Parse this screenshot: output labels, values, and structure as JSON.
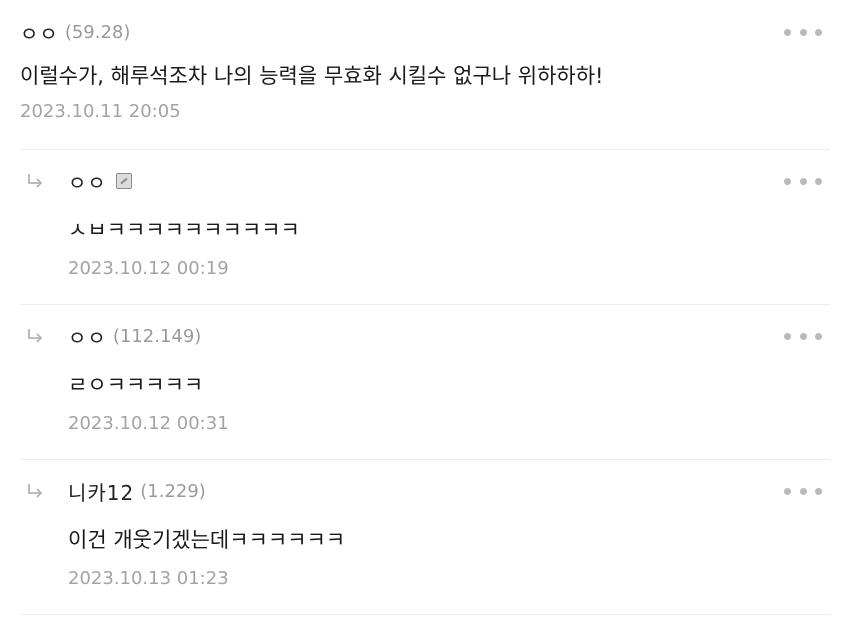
{
  "comments": [
    {
      "author": "ㅇㅇ",
      "ip": "(59.28)",
      "text": "이럴수가, 해루석조차 나의 능력을 무효화 시킬수 없구나 위하하하!",
      "time": "2023.10.11 20:05",
      "is_reply": false
    },
    {
      "author": "ㅇㅇ",
      "ip": "",
      "has_badge": true,
      "text": "ㅅㅂㅋㅋㅋㅋㅋㅋㅋㅋㅋㅋ",
      "time": "2023.10.12 00:19",
      "is_reply": true
    },
    {
      "author": "ㅇㅇ",
      "ip": "(112.149)",
      "text": "ㄹㅇㅋㅋㅋㅋㅋ",
      "time": "2023.10.12 00:31",
      "is_reply": true
    },
    {
      "author": "니카12",
      "ip": "(1.229)",
      "text": "이건 개웃기겠는데ㅋㅋㅋㅋㅋㅋ",
      "time": "2023.10.13 01:23",
      "is_reply": true
    }
  ],
  "icons": {
    "more": "more-dots-icon",
    "reply": "reply-arrow-icon",
    "badge": "fixed-nick-badge-icon"
  },
  "colors": {
    "meta": "#a3a3a3",
    "divider": "#ececec",
    "dots": "#b9b9b9"
  }
}
